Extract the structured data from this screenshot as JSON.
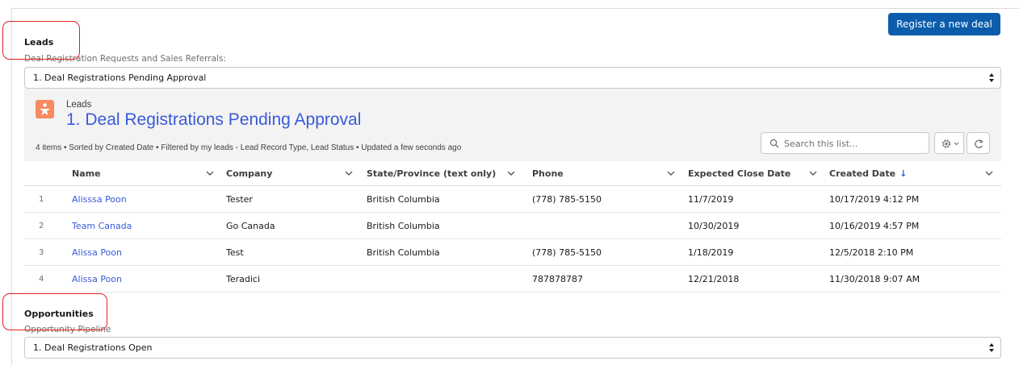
{
  "actions": {
    "register_label": "Register a new deal"
  },
  "leads_section": {
    "title": "Leads",
    "subtitle": "Deal Registration Requests and Sales Referrals:",
    "selected_view": "1. Deal Registrations Pending Approval"
  },
  "list_view": {
    "object_label": "Leads",
    "title": "1. Deal Registrations Pending Approval",
    "meta": "4 items • Sorted by Created Date • Filtered by my leads - Lead Record Type, Lead Status • Updated a few seconds ago",
    "search_placeholder": "Search this list...",
    "icons": {
      "object": "lead-person-icon",
      "settings": "gear-icon",
      "refresh": "refresh-icon",
      "search": "search-icon",
      "sort": "arrow-down-icon"
    },
    "columns": [
      "Name",
      "Company",
      "State/Province (text only)",
      "Phone",
      "Expected Close Date",
      "Created Date"
    ],
    "sorted_column_arrow": "↓",
    "rows": [
      {
        "num": "1",
        "name": "Alisssa Poon",
        "company": "Tester",
        "state": "British Columbia",
        "phone": "(778) 785-5150",
        "close": "11/7/2019",
        "created": "10/17/2019 4:12 PM"
      },
      {
        "num": "2",
        "name": "Team Canada",
        "company": "Go Canada",
        "state": "British Columbia",
        "phone": "",
        "close": "10/30/2019",
        "created": "10/16/2019 4:57 PM"
      },
      {
        "num": "3",
        "name": "Alissa Poon",
        "company": "Test",
        "state": "British Columbia",
        "phone": "(778) 785-5150",
        "close": "1/18/2019",
        "created": "12/5/2018 2:10 PM"
      },
      {
        "num": "4",
        "name": "Alissa Poon",
        "company": "Teradici",
        "state": "",
        "phone": "787878787",
        "close": "12/21/2018",
        "created": "11/30/2018 9:07 AM"
      }
    ]
  },
  "opportunities_section": {
    "title": "Opportunities",
    "subtitle": "Opportunity Pipeline",
    "selected_view": "1. Deal Registrations Open"
  },
  "colors": {
    "brand_button": "#0b5cab",
    "link": "#3a59d9",
    "lead_icon": "#f88962",
    "callout": "#e3201f"
  }
}
